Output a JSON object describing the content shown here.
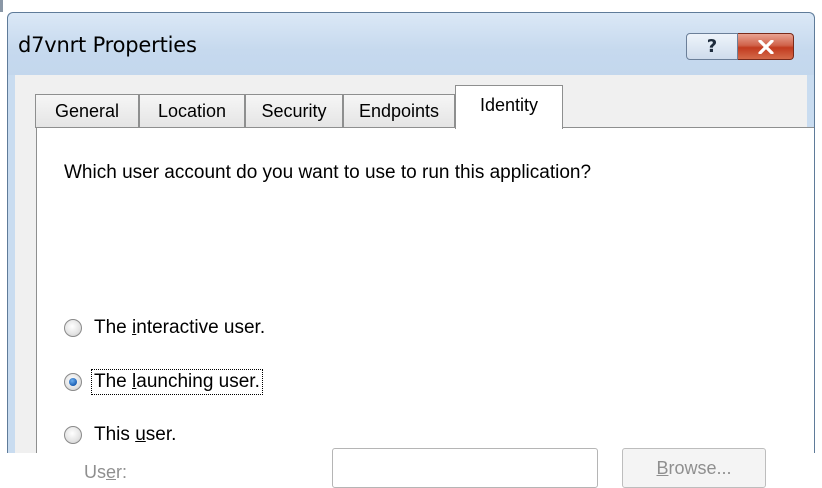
{
  "window": {
    "title": "d7vnrt Properties",
    "help_glyph": "?",
    "close_icon": "close-icon"
  },
  "tabs": [
    {
      "label": "General",
      "active": false
    },
    {
      "label": "Location",
      "active": false
    },
    {
      "label": "Security",
      "active": false
    },
    {
      "label": "Endpoints",
      "active": false
    },
    {
      "label": "Identity",
      "active": true
    }
  ],
  "identity": {
    "question": "Which user account do you want to use to run this application?",
    "options": [
      {
        "pre": "The ",
        "key": "i",
        "post": "nteractive user.",
        "checked": false
      },
      {
        "pre": "The ",
        "key": "l",
        "post": "aunching user.",
        "checked": true
      },
      {
        "pre": "This ",
        "key": "u",
        "post": "ser.",
        "checked": false
      }
    ],
    "user_label": {
      "pre": "Us",
      "key": "e",
      "post": "r:"
    },
    "user_value": "",
    "browse_button": {
      "pre": "",
      "key": "B",
      "post": "rowse..."
    }
  },
  "colors": {
    "title_bar": "#c6d9ee",
    "close_button": "#c23b1f",
    "disabled_text": "#8f8f8f",
    "selected_radio": "#1a5fb4"
  }
}
